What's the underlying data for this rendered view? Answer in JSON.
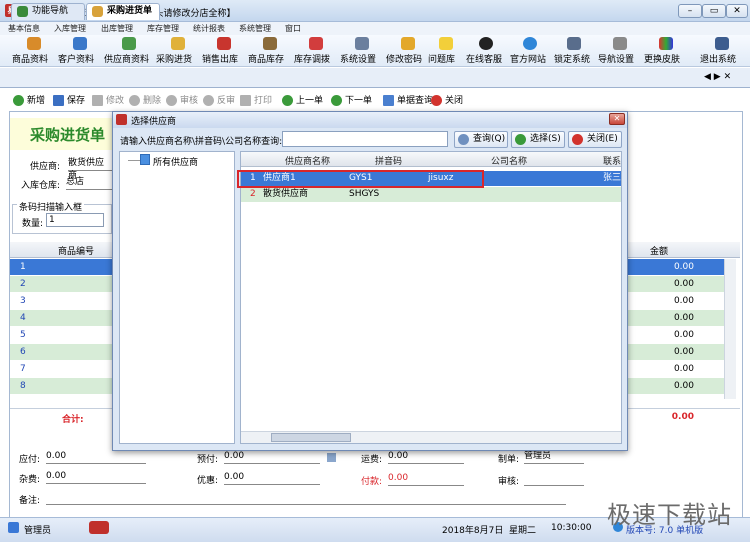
{
  "window": {
    "title": "易特办公用品管理软件--【单据抬头请修改分店全称】",
    "icon_label": "易"
  },
  "menu": [
    "基本信息",
    "入库管理",
    "出库管理",
    "库存管理",
    "统计报表",
    "系统管理",
    "窗口"
  ],
  "toolbar": [
    {
      "label": "商品资料",
      "icon": "box-icon"
    },
    {
      "label": "客户资料",
      "icon": "user-icon"
    },
    {
      "label": "供应商资料",
      "icon": "supplier-icon"
    },
    {
      "label": "采购进货",
      "icon": "truck-icon"
    },
    {
      "label": "销售出库",
      "icon": "cart-icon"
    },
    {
      "label": "商品库存",
      "icon": "warehouse-icon"
    },
    {
      "label": "库存调拨",
      "icon": "transfer-icon"
    },
    {
      "label": "系统设置",
      "icon": "gear-icon"
    },
    {
      "label": "修改密码",
      "icon": "key-icon"
    },
    {
      "label": "问题库",
      "icon": "lightbulb-icon"
    },
    {
      "label": "在线客服",
      "icon": "qq-icon"
    },
    {
      "label": "官方网站",
      "icon": "ie-icon"
    },
    {
      "label": "锁定系统",
      "icon": "lock-icon"
    },
    {
      "label": "导航设置",
      "icon": "nav-icon"
    },
    {
      "label": "更换皮肤",
      "icon": "skin-icon"
    },
    {
      "label": "退出系统",
      "icon": "exit-icon"
    }
  ],
  "tabs": [
    {
      "label": "功能导航"
    },
    {
      "label": "采购进货单"
    }
  ],
  "subtoolbar": [
    "新增",
    "保存",
    "修改",
    "删除",
    "审核",
    "反审",
    "打印",
    "上一单",
    "下一单",
    "单据查询",
    "关闭"
  ],
  "form": {
    "title": "采购进货单",
    "supplier_label": "供应商:",
    "supplier_value": "散货供应商",
    "warehouse_label": "入库仓库:",
    "warehouse_value": "总店",
    "barcode_group": "条码扫描输入框",
    "qty_label": "数量:",
    "qty_value": "1"
  },
  "grid": {
    "col_code": "商品编号",
    "col_amount": "金额",
    "rows": [
      {
        "n": "1",
        "amount": "0.00"
      },
      {
        "n": "2",
        "amount": "0.00"
      },
      {
        "n": "3",
        "amount": "0.00"
      },
      {
        "n": "4",
        "amount": "0.00"
      },
      {
        "n": "5",
        "amount": "0.00"
      },
      {
        "n": "6",
        "amount": "0.00"
      },
      {
        "n": "7",
        "amount": "0.00"
      },
      {
        "n": "8",
        "amount": "0.00"
      }
    ],
    "total_label": "合计:",
    "total_amount": "0.00"
  },
  "footer": {
    "payable_label": "应付:",
    "payable_value": "0.00",
    "prepaid_label": "预付:",
    "prepaid_value": "0.00",
    "freight_label": "运费:",
    "freight_value": "0.00",
    "maker_label": "制单:",
    "maker_value": "管理员",
    "misc_label": "杂费:",
    "misc_value": "0.00",
    "discount_label": "优惠:",
    "discount_value": "0.00",
    "paid_label": "付款:",
    "paid_value": "0.00",
    "auditor_label": "审核:",
    "remark_label": "备注:"
  },
  "dialog": {
    "title": "选择供应商",
    "search_label": "请输入供应商名称\\拼音码\\公司名称查询:",
    "search_value": "",
    "query_btn": "查询(Q)",
    "select_btn": "选择(S)",
    "close_btn": "关闭(E)",
    "tree_root": "所有供应商",
    "columns": [
      "供应商名称",
      "拼音码",
      "公司名称",
      "联系"
    ],
    "rows": [
      {
        "n": "1",
        "name": "供应商1",
        "code": "GYS1",
        "company": "jisuxz",
        "contact": "张三"
      },
      {
        "n": "2",
        "name": "散货供应商",
        "code": "SHGYS",
        "company": "",
        "contact": ""
      }
    ]
  },
  "status": {
    "user": "管理员",
    "date": "2018年8月7日",
    "weekday": "星期二",
    "time": "10:30:00",
    "version": "版本号: 7.0 单机版"
  },
  "watermark": "极速下载站",
  "colors": {
    "accent_green": "#2c8a2c",
    "selection": "#3a78d6",
    "red_box": "#d9262b"
  }
}
